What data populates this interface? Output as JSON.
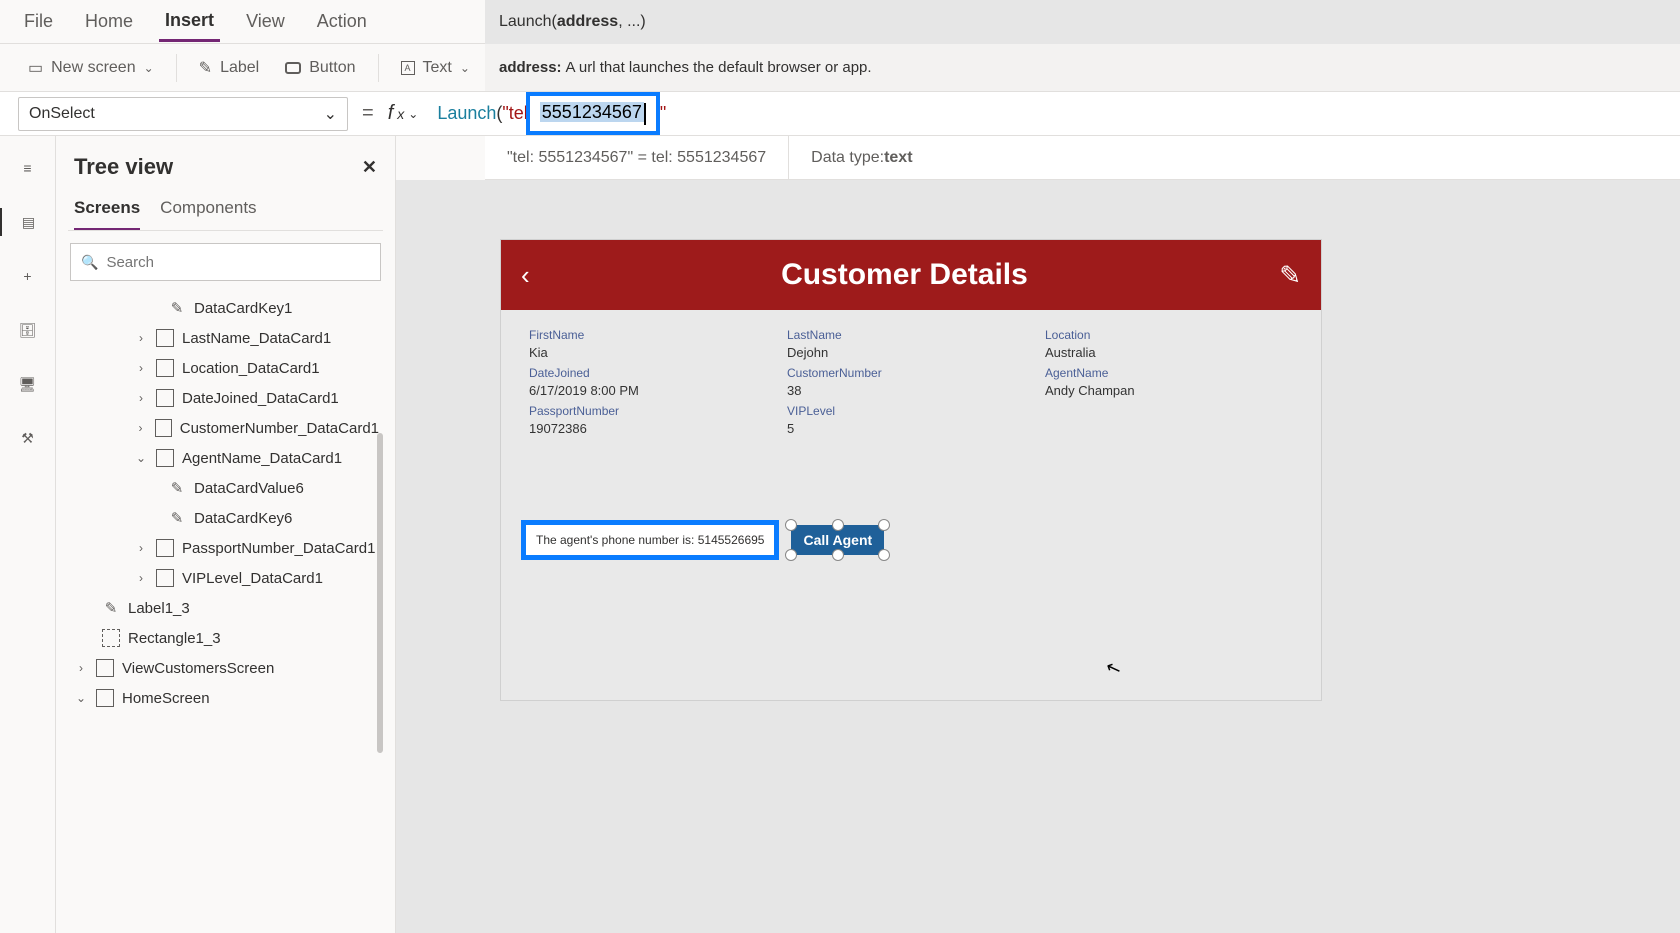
{
  "menus": {
    "file": "File",
    "home": "Home",
    "insert": "Insert",
    "view": "View",
    "action": "Action"
  },
  "toolbar": {
    "new_screen": "New screen",
    "label": "Label",
    "button": "Button",
    "text": "Text"
  },
  "hint": {
    "signature_prefix": "Launch(",
    "signature_arg": "address",
    "signature_suffix": ", ...)",
    "desc_key": "address:",
    "desc_text": "A url that launches the default browser or app."
  },
  "formula": {
    "property": "OnSelect",
    "fn": "Launch",
    "str_pre": "\"tel",
    "phone": "5551234567",
    "str_post": "\"",
    "open": "(",
    "result_left": "\"tel: 5551234567\"   =   tel: 5551234567",
    "datatype_label": "Data type: ",
    "datatype_value": "text"
  },
  "tree": {
    "title": "Tree view",
    "tab_screens": "Screens",
    "tab_components": "Components",
    "search_placeholder": "Search",
    "nodes": {
      "datacardkey1": "DataCardKey1",
      "lastname": "LastName_DataCard1",
      "location": "Location_DataCard1",
      "datejoined": "DateJoined_DataCard1",
      "custnum": "CustomerNumber_DataCard1",
      "agentname": "AgentName_DataCard1",
      "dcvalue6": "DataCardValue6",
      "dckey6": "DataCardKey6",
      "passport": "PassportNumber_DataCard1",
      "viplevel": "VIPLevel_DataCard1",
      "label13": "Label1_3",
      "rect13": "Rectangle1_3",
      "viewcust": "ViewCustomersScreen",
      "homescr": "HomeScreen"
    }
  },
  "app": {
    "title": "Customer Details",
    "fields": {
      "firstname_l": "FirstName",
      "firstname_v": "Kia",
      "lastname_l": "LastName",
      "lastname_v": "Dejohn",
      "location_l": "Location",
      "location_v": "Australia",
      "datejoined_l": "DateJoined",
      "datejoined_v": "6/17/2019 8:00 PM",
      "custnum_l": "CustomerNumber",
      "custnum_v": "38",
      "agent_l": "AgentName",
      "agent_v": "Andy Champan",
      "passport_l": "PassportNumber",
      "passport_v": "19072386",
      "vip_l": "VIPLevel",
      "vip_v": "5"
    },
    "phone_label": "The agent's phone number is:  5145526695",
    "call_btn": "Call Agent"
  }
}
